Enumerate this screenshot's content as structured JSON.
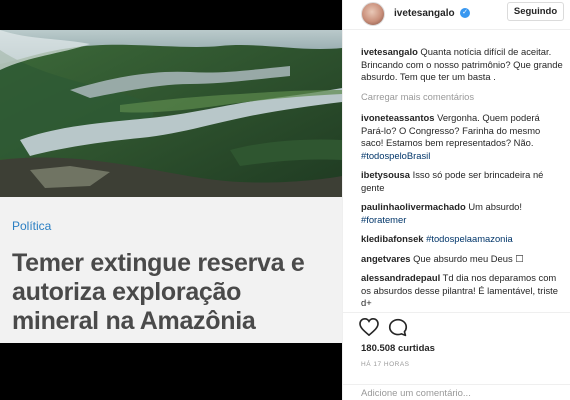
{
  "post": {
    "category": "Política",
    "headline": "Temer extingue reserva e autoriza exploração mineral na Amazônia"
  },
  "header": {
    "username": "ivetesangalo",
    "verified_mark": "✓",
    "follow_label": "Seguindo"
  },
  "caption": {
    "user": "ivetesangalo",
    "text": "Quanta notícia difícil de aceitar. Brincando com o nosso patrimônio? Que grande absurdo. Tem que ter um basta ."
  },
  "load_more": "Carregar mais comentários",
  "comments": [
    {
      "user": "ivoneteassantos",
      "text": "Vergonha. Quem poderá Pará-lo? O Congresso? Farinha do mesmo saco! Estamos bem representados? Não.",
      "hashtag": "#todospeloBrasil"
    },
    {
      "user": "ibetysousa",
      "text": "Isso só pode ser brincadeira né gente",
      "hashtag": ""
    },
    {
      "user": "paulinhaolivermachado",
      "text": "Um absurdo!",
      "hashtag": "#foratemer"
    },
    {
      "user": "kledibafonsek",
      "text": "",
      "hashtag": "#todospelaamazonia"
    },
    {
      "user": "angetvares",
      "text": "Que absurdo meu Deus ☐",
      "hashtag": ""
    },
    {
      "user": "alessandradepaul",
      "text": "Td dia nos deparamos com os absurdos desse pilantra! É lamentável, triste d+",
      "hashtag": ""
    }
  ],
  "actions": {
    "like_icon": "heart-icon",
    "comment_icon": "speech-bubble-icon",
    "likes": "180.508 curtidas",
    "time": "HÁ 17 HORAS",
    "add_comment_placeholder": "Adicione um comentário..."
  },
  "colors": {
    "hashtag": "#003569",
    "category": "#2b7fc3",
    "verified": "#3897f0"
  }
}
